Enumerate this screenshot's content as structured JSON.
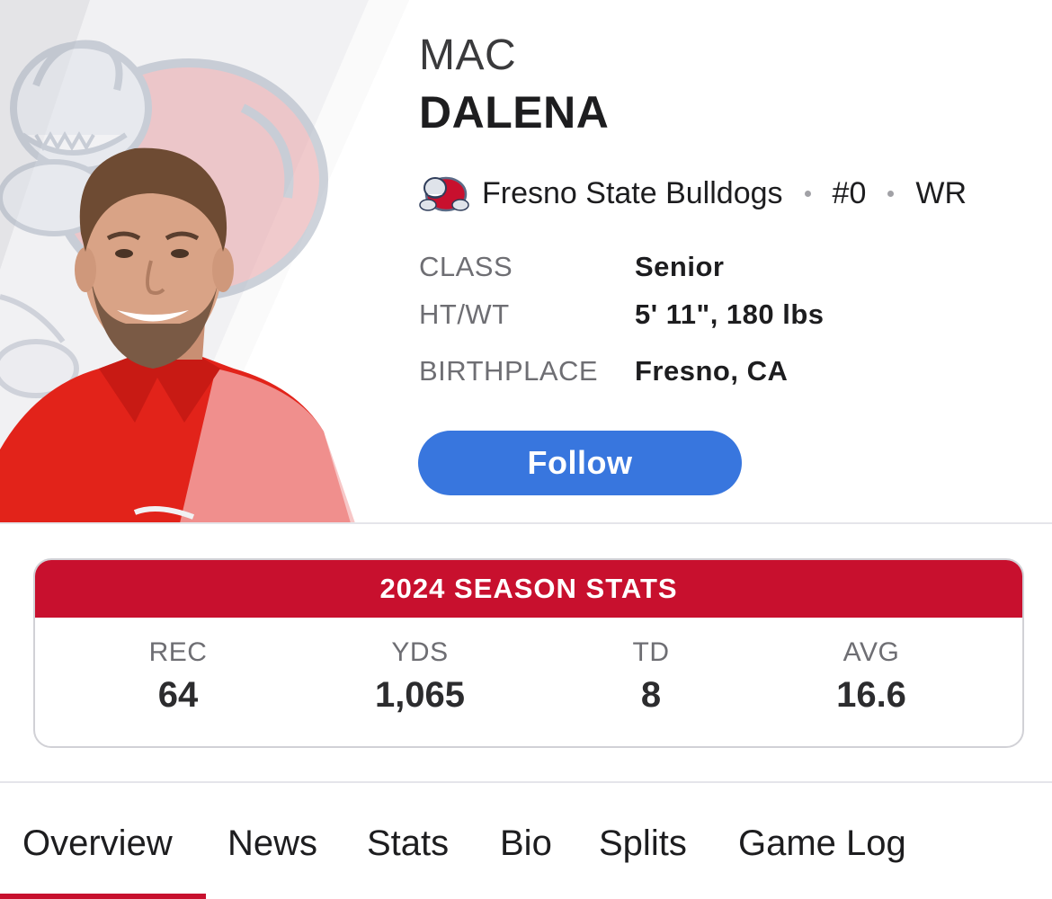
{
  "player": {
    "first_name": "MAC",
    "last_name": "DALENA",
    "team": "Fresno State Bulldogs",
    "number": "#0",
    "position": "WR"
  },
  "info": [
    {
      "label": "CLASS",
      "value": "Senior"
    },
    {
      "label": "HT/WT",
      "value": "5' 11\", 180 lbs"
    },
    {
      "label": "BIRTHPLACE",
      "value": "Fresno, CA"
    }
  ],
  "follow_label": "Follow",
  "stats": {
    "title": "2024 SEASON STATS",
    "items": [
      {
        "label": "REC",
        "value": "64"
      },
      {
        "label": "YDS",
        "value": "1,065"
      },
      {
        "label": "TD",
        "value": "8"
      },
      {
        "label": "AVG",
        "value": "16.6"
      }
    ]
  },
  "tabs": [
    {
      "label": "Overview",
      "active": true
    },
    {
      "label": "News"
    },
    {
      "label": "Stats"
    },
    {
      "label": "Bio"
    },
    {
      "label": "Splits"
    },
    {
      "label": "Game Log"
    }
  ],
  "colors": {
    "accent_red": "#c8102e",
    "follow_blue": "#3876de",
    "label_gray": "#6e6e73"
  },
  "icons": {
    "team_logo": "bulldog-logo-icon",
    "separator": "dot-separator"
  }
}
